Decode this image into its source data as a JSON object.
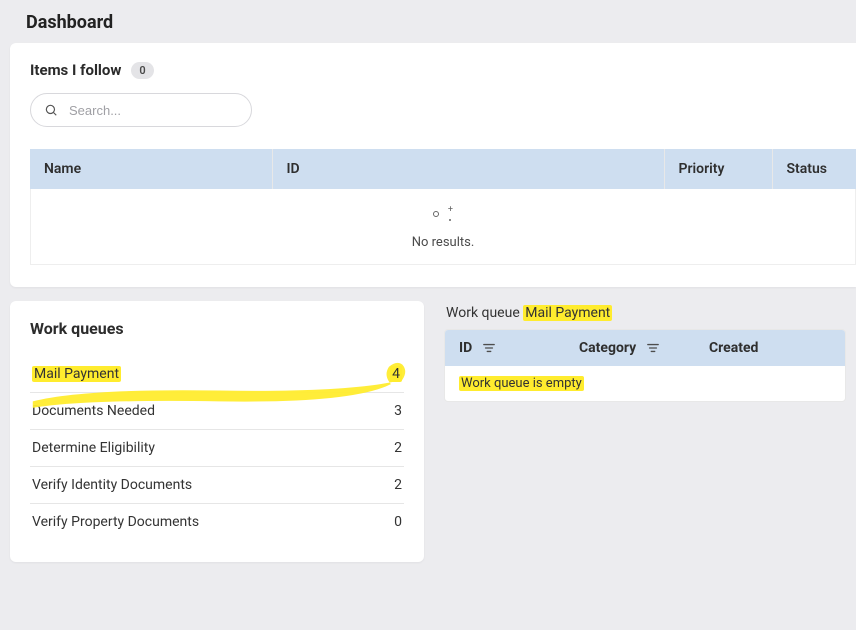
{
  "page_title": "Dashboard",
  "items_follow": {
    "title": "Items I follow",
    "count": "0",
    "search_placeholder": "Search...",
    "columns": {
      "name": "Name",
      "id": "ID",
      "priority": "Priority",
      "status": "Status"
    },
    "no_results": "No results."
  },
  "work_queues": {
    "title": "Work queues",
    "rows": [
      {
        "label": "Mail Payment",
        "count": "4"
      },
      {
        "label": "Documents Needed",
        "count": "3"
      },
      {
        "label": "Determine Eligibility",
        "count": "2"
      },
      {
        "label": "Verify Identity Documents",
        "count": "2"
      },
      {
        "label": "Verify Property Documents",
        "count": "0"
      }
    ]
  },
  "work_queue_detail": {
    "title_prefix": "Work queue",
    "title_name": "Mail Payment",
    "columns": {
      "id": "ID",
      "category": "Category",
      "created": "Created"
    },
    "empty_text": "Work queue is empty"
  }
}
